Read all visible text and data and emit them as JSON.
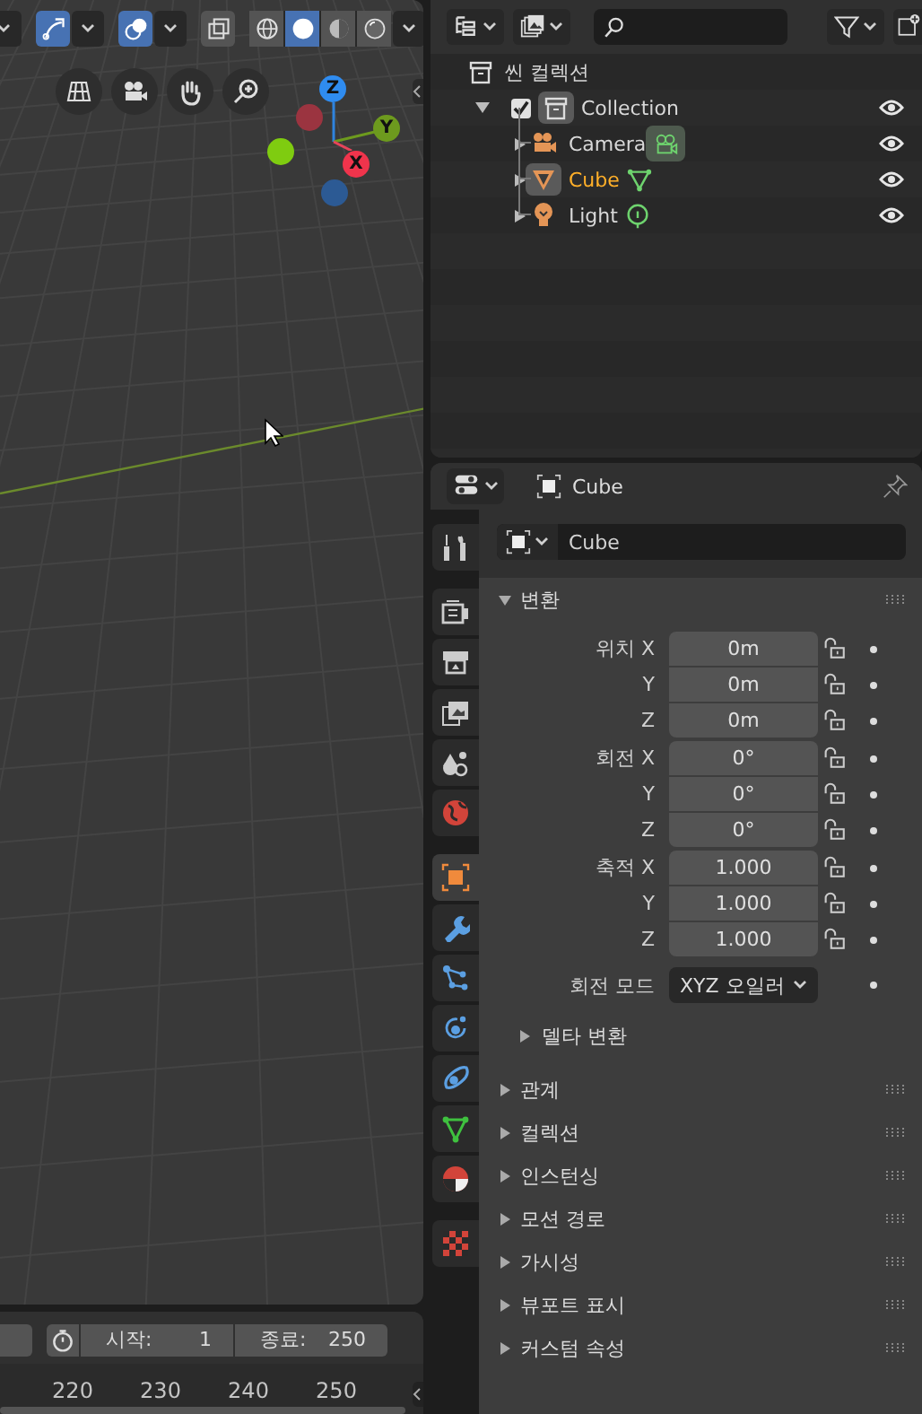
{
  "viewport": {
    "toggles": [
      {
        "kind": "proportional",
        "on": true
      },
      {
        "kind": "overlays",
        "on": true
      },
      {
        "kind": "xray",
        "on": false
      }
    ],
    "shading": [
      {
        "kind": "wireframe",
        "selected": false
      },
      {
        "kind": "solid",
        "selected": true
      },
      {
        "kind": "material",
        "selected": false
      },
      {
        "kind": "rendered",
        "selected": false
      }
    ],
    "gizmo": {
      "z": "Z",
      "y": "Y",
      "x": "X"
    }
  },
  "timeline": {
    "start_label": "시작:",
    "start": "1",
    "end_label": "종료:",
    "end": "250",
    "ticks": [
      "220",
      "230",
      "240",
      "250"
    ]
  },
  "outliner": {
    "root": "씬 컬렉션",
    "collection": {
      "name": "Collection",
      "checked": true,
      "expanded": true,
      "children": [
        {
          "kind": "camera",
          "name": "Camera",
          "active": false,
          "data_active": true
        },
        {
          "kind": "mesh",
          "name": "Cube",
          "active": true,
          "data_active": false
        },
        {
          "kind": "light",
          "name": "Light",
          "active": false,
          "data_active": false
        }
      ]
    }
  },
  "properties": {
    "title": "Cube",
    "name": "Cube",
    "tab_groups": [
      [
        {
          "kind": "tool",
          "selected": false
        }
      ],
      [
        {
          "kind": "render",
          "selected": false
        },
        {
          "kind": "output",
          "selected": false
        },
        {
          "kind": "view_layer",
          "selected": false
        },
        {
          "kind": "scene",
          "selected": false
        },
        {
          "kind": "world",
          "selected": false
        }
      ],
      [
        {
          "kind": "object",
          "selected": true
        },
        {
          "kind": "modifiers",
          "selected": false
        },
        {
          "kind": "particles",
          "selected": false
        },
        {
          "kind": "physics",
          "selected": false
        },
        {
          "kind": "constraints",
          "selected": false
        },
        {
          "kind": "data",
          "selected": false
        },
        {
          "kind": "material",
          "selected": false
        }
      ],
      [
        {
          "kind": "texture",
          "selected": false
        }
      ]
    ],
    "panels": [
      {
        "title": "변환",
        "expanded": true,
        "rows": [
          {
            "kind": "vector",
            "fields": [
              {
                "label": "위치 X",
                "value": "0m",
                "locked": false
              },
              {
                "label": "Y",
                "value": "0m",
                "locked": false
              },
              {
                "label": "Z",
                "value": "0m",
                "locked": false
              }
            ]
          },
          {
            "kind": "vector",
            "fields": [
              {
                "label": "회전 X",
                "value": "0°",
                "locked": false
              },
              {
                "label": "Y",
                "value": "0°",
                "locked": false
              },
              {
                "label": "Z",
                "value": "0°",
                "locked": false
              }
            ]
          },
          {
            "kind": "vector",
            "fields": [
              {
                "label": "축적 X",
                "value": "1.000",
                "locked": false
              },
              {
                "label": "Y",
                "value": "1.000",
                "locked": false
              },
              {
                "label": "Z",
                "value": "1.000",
                "locked": false
              }
            ]
          },
          {
            "kind": "enum",
            "label": "회전 모드",
            "value": "XYZ 오일러"
          },
          {
            "kind": "subpanel",
            "label": "델타 변환",
            "expanded": false
          }
        ]
      },
      {
        "title": "관계",
        "expanded": false
      },
      {
        "title": "컬렉션",
        "expanded": false
      },
      {
        "title": "인스턴싱",
        "expanded": false
      },
      {
        "title": "모션 경로",
        "expanded": false
      },
      {
        "title": "가시성",
        "expanded": false
      },
      {
        "title": "뷰포트 표시",
        "expanded": false
      },
      {
        "title": "커스텀 속성",
        "expanded": false
      }
    ]
  }
}
